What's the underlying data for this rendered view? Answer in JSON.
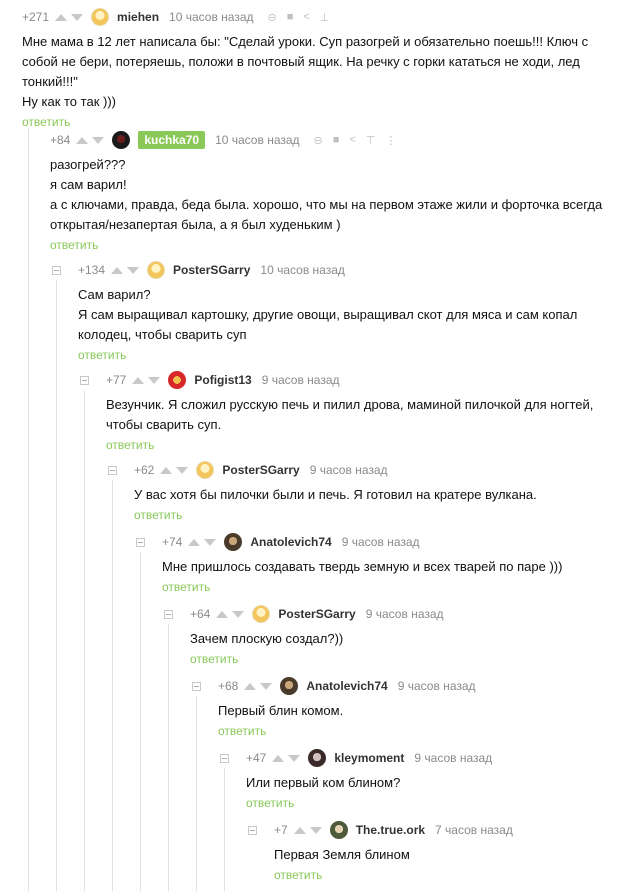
{
  "reply_label": "ответить",
  "comments": [
    {
      "score": "+271",
      "author": "miehen",
      "time": "10 часов назад",
      "lines": [
        "Мне мама в 12 лет написала бы: \"Сделай уроки. Суп разогрей и обязательно поешь!!! Ключ с собой не бери, потеряешь, положи в почтовый ящик. На речку с горки кататься не ходи, лед тонкий!!!\"",
        "Ну как то так )))"
      ]
    },
    {
      "score": "+84",
      "author": "kuchka70",
      "time": "10 часов назад",
      "lines": [
        "разогрей???",
        "я сам варил!",
        "а с ключами, правда, беда была. хорошо, что мы на первом этаже жили и форточка всегда открытая/незапертая была, а я был худеньким )"
      ]
    },
    {
      "score": "+134",
      "author": "PosterSGarry",
      "time": "10 часов назад",
      "lines": [
        "Сам варил?",
        "Я сам выращивал картошку, другие овощи, выращивал скот для мяса и сам копал колодец, чтобы сварить суп"
      ]
    },
    {
      "score": "+77",
      "author": "Pofigist13",
      "time": "9 часов назад",
      "lines": [
        "Везунчик. Я сложил русскую печь и пилил дрова, маминой пилочкой для ногтей, чтобы сварить суп."
      ]
    },
    {
      "score": "+62",
      "author": "PosterSGarry",
      "time": "9 часов назад",
      "lines": [
        "У вас хотя бы пилочки были и печь. Я готовил на кратере вулкана."
      ]
    },
    {
      "score": "+74",
      "author": "Anatolevich74",
      "time": "9 часов назад",
      "lines": [
        "Мне пришлось создавать твердь земную и всех тварей по паре )))"
      ]
    },
    {
      "score": "+64",
      "author": "PosterSGarry",
      "time": "9 часов назад",
      "lines": [
        "Зачем плоскую создал?))"
      ]
    },
    {
      "score": "+68",
      "author": "Anatolevich74",
      "time": "9 часов назад",
      "lines": [
        "Первый блин комом."
      ]
    },
    {
      "score": "+47",
      "author": "kleymoment",
      "time": "9 часов назад",
      "lines": [
        "Или первый ком блином?"
      ]
    },
    {
      "score": "+7",
      "author": "The.true.ork",
      "time": "7 часов назад",
      "lines": [
        "Первая Земля блином"
      ]
    }
  ]
}
